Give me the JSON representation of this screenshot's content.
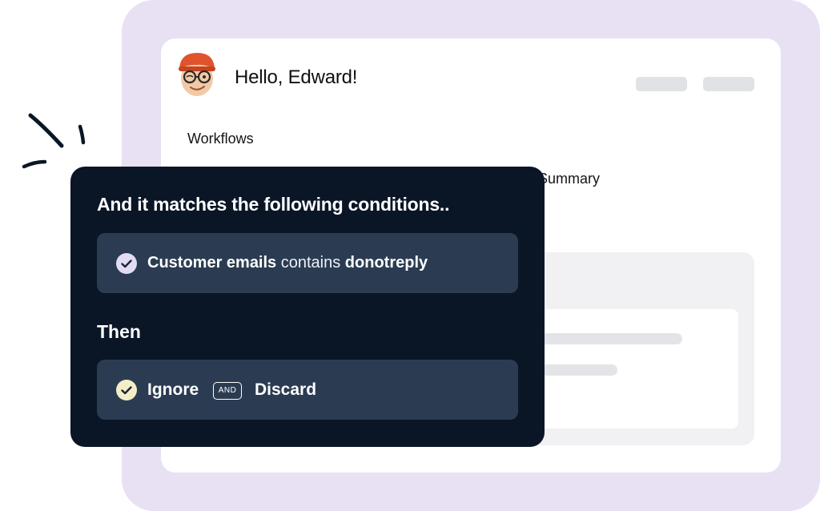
{
  "header": {
    "greeting": "Hello, Edward!"
  },
  "nav": {
    "workflows_label": "Workflows",
    "summary_label": "Summary"
  },
  "rule_card": {
    "conditions_heading": "And it matches the following conditions..",
    "condition": {
      "field": "Customer emails",
      "operator": "contains",
      "value": "donotreply"
    },
    "then_heading": "Then",
    "actions": [
      "Ignore",
      "Discard"
    ],
    "connector": "AND"
  },
  "icons": {
    "condition_check": "check-circle-icon",
    "action_check": "check-circle-icon",
    "avatar": "avatar-memoji"
  },
  "colors": {
    "background_accent": "#e8e0f3",
    "dark_card": "#0a1626",
    "row_fill": "#2b3c52",
    "condition_check": "#e3dbf5",
    "action_check": "#f4eec8"
  }
}
